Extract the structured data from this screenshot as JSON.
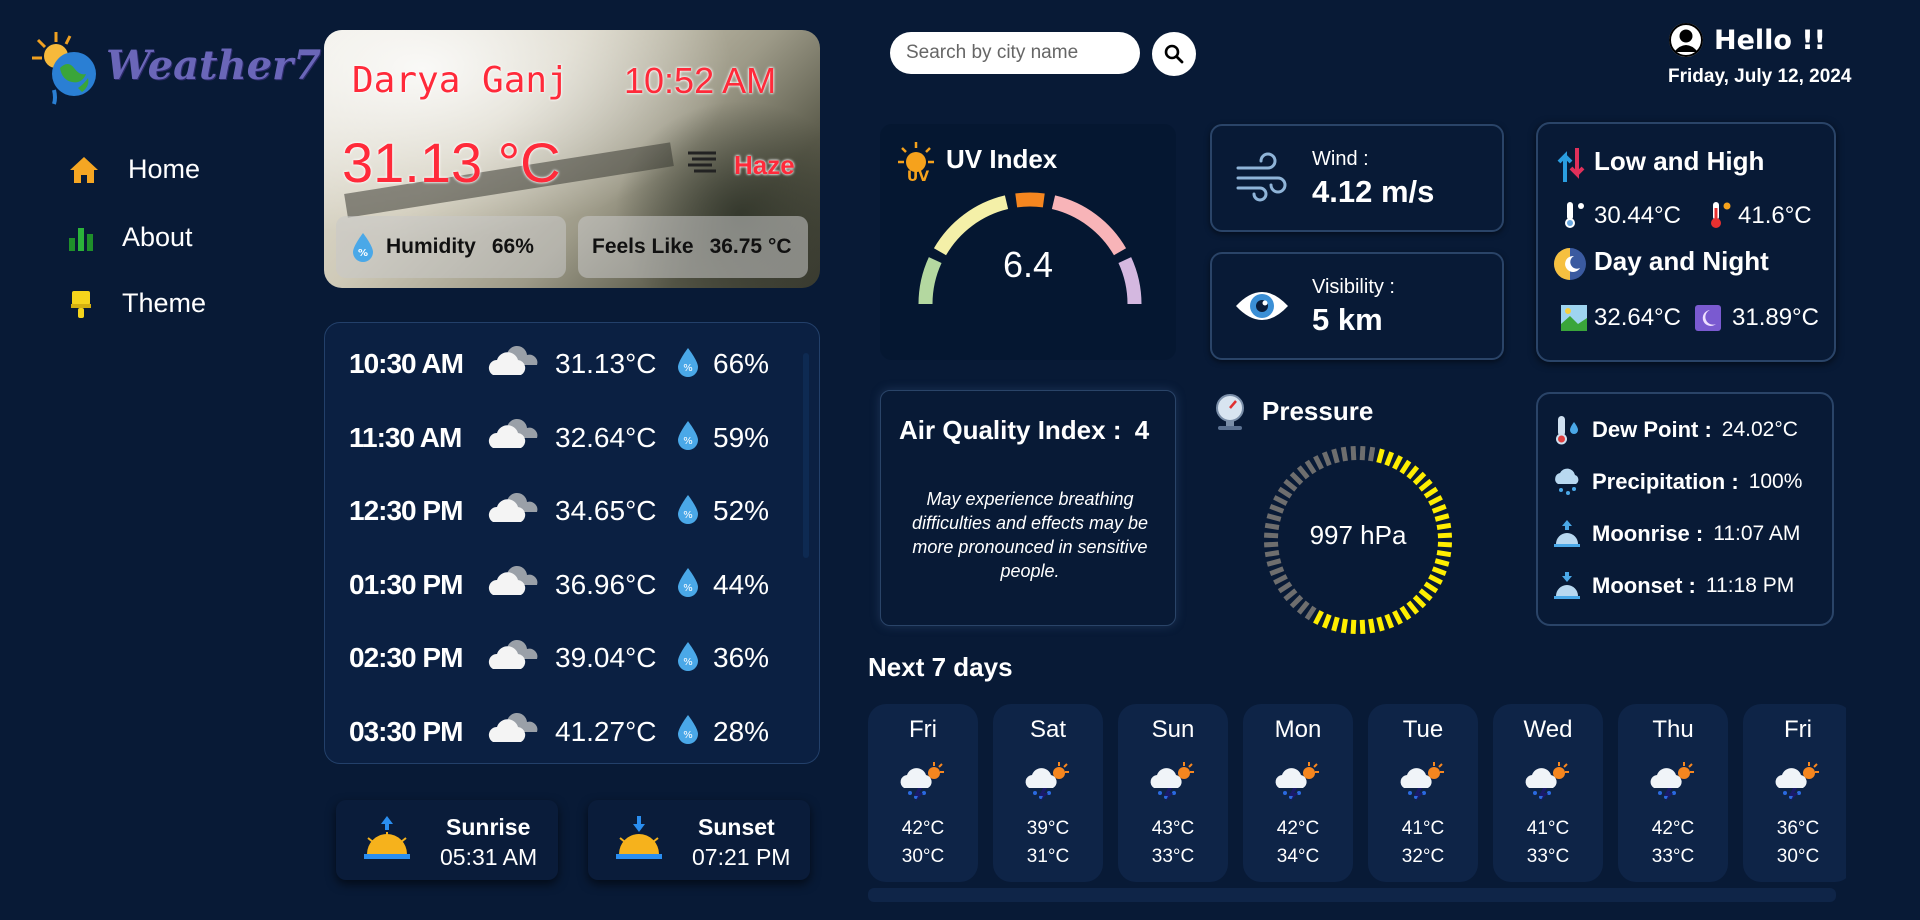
{
  "brand": {
    "name": "Weather7"
  },
  "nav": [
    {
      "label": "Home",
      "icon": "home-icon",
      "color": "#f5a623"
    },
    {
      "label": "About",
      "icon": "bar-chart-icon",
      "color": "#1f8f2a"
    },
    {
      "label": "Theme",
      "icon": "paintbrush-icon",
      "color": "#f5d41c"
    }
  ],
  "current": {
    "city": "Darya Ganj",
    "time": "10:52 AM",
    "temp": "31.13 °C",
    "condition": "Haze",
    "humidity_label": "Humidity",
    "humidity": "66%",
    "feels_label": "Feels Like",
    "feels": "36.75 °C"
  },
  "hourly": [
    {
      "time": "10:30 AM",
      "temp": "31.13°C",
      "humidity": "66%"
    },
    {
      "time": "11:30 AM",
      "temp": "32.64°C",
      "humidity": "59%"
    },
    {
      "time": "12:30 PM",
      "temp": "34.65°C",
      "humidity": "52%"
    },
    {
      "time": "01:30 PM",
      "temp": "36.96°C",
      "humidity": "44%"
    },
    {
      "time": "02:30 PM",
      "temp": "39.04°C",
      "humidity": "36%"
    },
    {
      "time": "03:30 PM",
      "temp": "41.27°C",
      "humidity": "28%"
    }
  ],
  "sun": {
    "sunrise_label": "Sunrise",
    "sunrise": "05:31 AM",
    "sunset_label": "Sunset",
    "sunset": "07:21 PM"
  },
  "search": {
    "placeholder": "Search by city name"
  },
  "header": {
    "greeting": "Hello !!",
    "date": "Friday, July 12, 2024"
  },
  "uv": {
    "title": "UV Index",
    "value": "6.4"
  },
  "wind": {
    "label": "Wind :",
    "value": "4.12 m/s"
  },
  "visibility": {
    "label": "Visibility :",
    "value": "5 km"
  },
  "low_high": {
    "title": "Low and High",
    "low": "30.44°C",
    "high": "41.6°C"
  },
  "day_night": {
    "title": "Day and Night",
    "day": "32.64°C",
    "night": "31.89°C"
  },
  "aqi": {
    "title": "Air Quality Index :",
    "value": "4",
    "description": "May experience breathing difficulties and effects may be more pronounced in sensitive people."
  },
  "pressure": {
    "title": "Pressure",
    "value": "997 hPa",
    "fill_fraction": 0.55
  },
  "misc": {
    "dew_label": "Dew Point :",
    "dew": "24.02°C",
    "precip_label": "Precipitation :",
    "precip": "100%",
    "moonrise_label": "Moonrise :",
    "moonrise": "11:07 AM",
    "moonset_label": "Moonset :",
    "moonset": "11:18 PM"
  },
  "forecast_title": "Next 7 days",
  "forecast": [
    {
      "day": "Fri",
      "hi": "42°C",
      "lo": "30°C"
    },
    {
      "day": "Sat",
      "hi": "39°C",
      "lo": "31°C"
    },
    {
      "day": "Sun",
      "hi": "43°C",
      "lo": "33°C"
    },
    {
      "day": "Mon",
      "hi": "42°C",
      "lo": "34°C"
    },
    {
      "day": "Tue",
      "hi": "41°C",
      "lo": "32°C"
    },
    {
      "day": "Wed",
      "hi": "41°C",
      "lo": "33°C"
    },
    {
      "day": "Thu",
      "hi": "42°C",
      "lo": "33°C"
    },
    {
      "day": "Fri",
      "hi": "36°C",
      "lo": "30°C"
    }
  ],
  "colors": {
    "background": "#081a36",
    "accent_red": "#ff2a3a",
    "gauge_yellow": "#ffee00"
  }
}
